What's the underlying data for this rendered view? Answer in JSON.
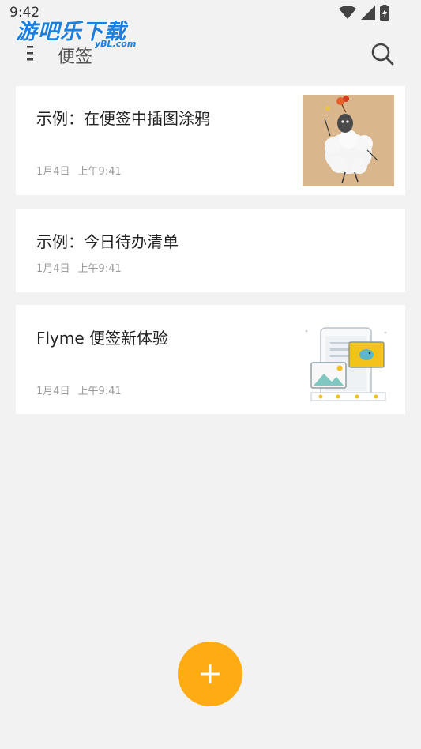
{
  "status_bar": {
    "time": "9:42",
    "icons": [
      "wifi-icon",
      "signal-icon",
      "battery-icon"
    ]
  },
  "watermark": {
    "main": "游吧乐下载",
    "sub": "yBL.com"
  },
  "toolbar": {
    "title": "便签",
    "menu_icon": "menu-icon",
    "search_icon": "search-icon"
  },
  "notes": [
    {
      "title": "示例：在便签中插图涂鸦",
      "date": "1月4日",
      "time": "上午9:41",
      "thumbnail": "sheep-doodle-image"
    },
    {
      "title": "示例：今日待办清单",
      "date": "1月4日",
      "time": "上午9:41"
    },
    {
      "title": "Flyme 便签新体验",
      "date": "1月4日",
      "time": "上午9:41",
      "thumbnail": "phone-illustration-image"
    }
  ],
  "fab": {
    "icon": "plus-icon"
  },
  "colors": {
    "accent": "#ffab14",
    "background": "#f2f2f2",
    "card": "#ffffff",
    "meta_text": "#9a9a9a"
  }
}
